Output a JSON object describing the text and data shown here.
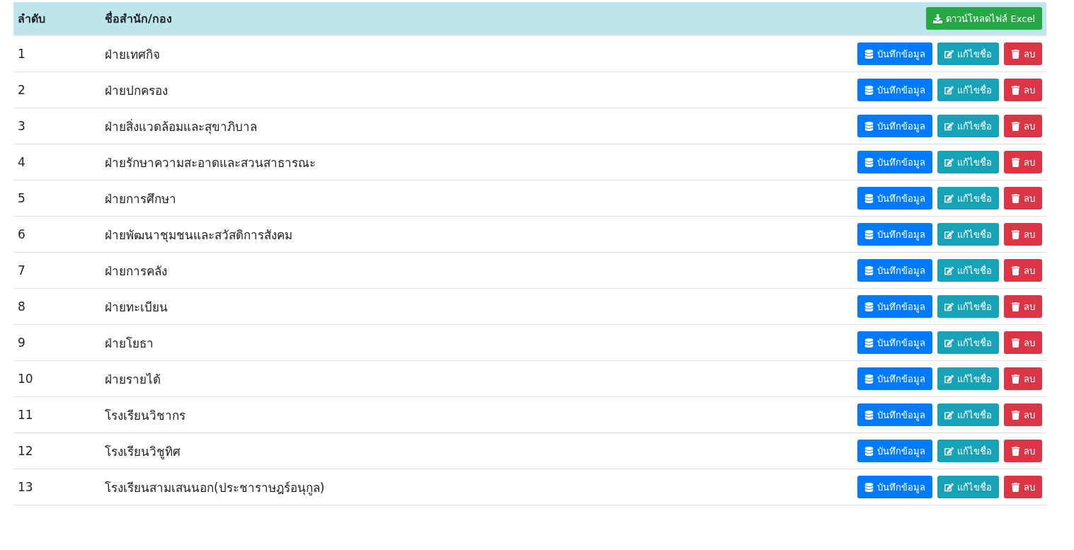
{
  "table": {
    "columns": [
      "ลำดับ",
      "ชื่อสำนัก/กอง"
    ],
    "download_button": {
      "label": "ดาวน์โหลดไฟล์ Excel"
    },
    "rows": [
      {
        "number": "1",
        "name": "ฝ่ายเทศกิจ",
        "actions": [
          {
            "kind": "save",
            "label": "บันทึกข้อมูล"
          },
          {
            "kind": "edit",
            "label": "แก้ไขชื่อ"
          },
          {
            "kind": "delete",
            "label": "ลบ"
          }
        ]
      },
      {
        "number": "2",
        "name": "ฝ่ายปกครอง",
        "actions": [
          {
            "kind": "save",
            "label": "บันทึกข้อมูล"
          },
          {
            "kind": "edit",
            "label": "แก้ไขชื่อ"
          },
          {
            "kind": "delete",
            "label": "ลบ"
          }
        ]
      },
      {
        "number": "3",
        "name": "ฝ่ายสิ่งแวดล้อมและสุขาภิบาล",
        "actions": [
          {
            "kind": "save",
            "label": "บันทึกข้อมูล"
          },
          {
            "kind": "edit",
            "label": "แก้ไขชื่อ"
          },
          {
            "kind": "delete",
            "label": "ลบ"
          }
        ]
      },
      {
        "number": "4",
        "name": "ฝ่ายรักษาความสะอาดและสวนสาธารณะ",
        "actions": [
          {
            "kind": "save",
            "label": "บันทึกข้อมูล"
          },
          {
            "kind": "edit",
            "label": "แก้ไขชื่อ"
          },
          {
            "kind": "delete",
            "label": "ลบ"
          }
        ]
      },
      {
        "number": "5",
        "name": "ฝ่ายการศึกษา",
        "actions": [
          {
            "kind": "save",
            "label": "บันทึกข้อมูล"
          },
          {
            "kind": "edit",
            "label": "แก้ไขชื่อ"
          },
          {
            "kind": "delete",
            "label": "ลบ"
          }
        ]
      },
      {
        "number": "6",
        "name": "ฝ่ายพัฒนาชุมชนและสวัสดิการสังคม",
        "actions": [
          {
            "kind": "save",
            "label": "บันทึกข้อมูล"
          },
          {
            "kind": "edit",
            "label": "แก้ไขชื่อ"
          },
          {
            "kind": "delete",
            "label": "ลบ"
          }
        ]
      },
      {
        "number": "7",
        "name": "ฝ่ายการคลัง",
        "actions": [
          {
            "kind": "save",
            "label": "บันทึกข้อมูล"
          },
          {
            "kind": "edit",
            "label": "แก้ไขชื่อ"
          },
          {
            "kind": "delete",
            "label": "ลบ"
          }
        ]
      },
      {
        "number": "8",
        "name": "ฝ่ายทะเบียน",
        "actions": [
          {
            "kind": "save",
            "label": "บันทึกข้อมูล"
          },
          {
            "kind": "edit",
            "label": "แก้ไขชื่อ"
          },
          {
            "kind": "delete",
            "label": "ลบ"
          }
        ]
      },
      {
        "number": "9",
        "name": "ฝ่ายโยธา",
        "actions": [
          {
            "kind": "save",
            "label": "บันทึกข้อมูล"
          },
          {
            "kind": "edit",
            "label": "แก้ไขชื่อ"
          },
          {
            "kind": "delete",
            "label": "ลบ"
          }
        ]
      },
      {
        "number": "10",
        "name": "ฝ่ายรายได้",
        "actions": [
          {
            "kind": "save",
            "label": "บันทึกข้อมูล"
          },
          {
            "kind": "edit",
            "label": "แก้ไขชื่อ"
          },
          {
            "kind": "delete",
            "label": "ลบ"
          }
        ]
      },
      {
        "number": "11",
        "name": "โรงเรียนวิชากร",
        "actions": [
          {
            "kind": "save",
            "label": "บันทึกข้อมูล"
          },
          {
            "kind": "edit",
            "label": "แก้ไขชื่อ"
          },
          {
            "kind": "delete",
            "label": "ลบ"
          }
        ]
      },
      {
        "number": "12",
        "name": "โรงเรียนวิชูทิศ",
        "actions": [
          {
            "kind": "save",
            "label": "บันทึกข้อมูล"
          },
          {
            "kind": "edit",
            "label": "แก้ไขชื่อ"
          },
          {
            "kind": "delete",
            "label": "ลบ"
          }
        ]
      },
      {
        "number": "13",
        "name": "โรงเรียนสามเสนนอก(ประชาราษฎร์อนุกูล)",
        "actions": [
          {
            "kind": "save",
            "label": "บันทึกข้อมูล"
          },
          {
            "kind": "edit",
            "label": "แก้ไขชื่อ"
          },
          {
            "kind": "delete",
            "label": "ลบ"
          }
        ]
      }
    ]
  }
}
